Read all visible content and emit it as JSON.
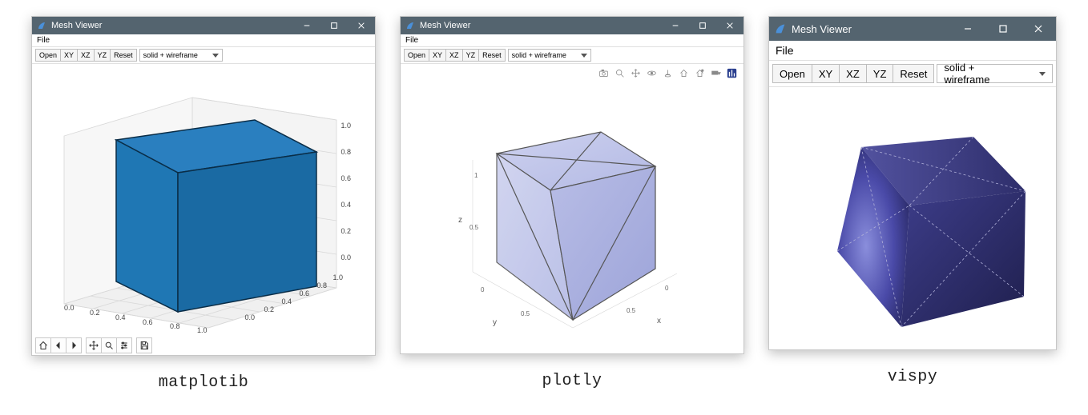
{
  "windows": [
    {
      "id": "mpl",
      "title": "Mesh Viewer",
      "menu": {
        "file": "File"
      },
      "toolbar": {
        "open": "Open",
        "xy": "XY",
        "xz": "XZ",
        "yz": "YZ",
        "reset": "Reset",
        "render_mode": "solid + wireframe"
      },
      "caption": "matplotib"
    },
    {
      "id": "plotly",
      "title": "Mesh Viewer",
      "menu": {
        "file": "File"
      },
      "toolbar": {
        "open": "Open",
        "xy": "XY",
        "xz": "XZ",
        "yz": "YZ",
        "reset": "Reset",
        "render_mode": "solid + wireframe"
      },
      "caption": "plotly"
    },
    {
      "id": "vispy",
      "title": "Mesh Viewer",
      "menu": {
        "file": "File"
      },
      "toolbar": {
        "open": "Open",
        "xy": "XY",
        "xz": "XZ",
        "yz": "YZ",
        "reset": "Reset",
        "render_mode": "solid + wireframe"
      },
      "caption": "vispy"
    }
  ],
  "mpl_nav_icons": [
    "home",
    "back",
    "forward",
    "pan",
    "zoom",
    "configure",
    "save"
  ],
  "plotly_icons": [
    "camera",
    "zoom",
    "pan",
    "rotate",
    "reset-axes",
    "home",
    "last",
    "cam3d",
    "logo"
  ],
  "chart_data": [
    {
      "renderer": "matplotlib",
      "type": "3d-surface",
      "object": "unit-cube",
      "vertices": [
        [
          0,
          0,
          0
        ],
        [
          1,
          0,
          0
        ],
        [
          1,
          1,
          0
        ],
        [
          0,
          1,
          0
        ],
        [
          0,
          0,
          1
        ],
        [
          1,
          0,
          1
        ],
        [
          1,
          1,
          1
        ],
        [
          0,
          1,
          1
        ]
      ],
      "face_color": "#1f77b4",
      "edge_color": "#0a2d47",
      "axes": {
        "x": {
          "ticks": [
            0.0,
            0.2,
            0.4,
            0.6,
            0.8,
            1.0
          ]
        },
        "y": {
          "ticks": [
            0.0,
            0.2,
            0.4,
            0.6,
            0.8,
            1.0
          ]
        },
        "z": {
          "ticks": [
            0.0,
            0.2,
            0.4,
            0.6,
            0.8,
            1.0
          ]
        }
      }
    },
    {
      "renderer": "plotly",
      "type": "mesh3d",
      "object": "unit-cube",
      "vertices": [
        [
          0,
          0,
          0
        ],
        [
          1,
          0,
          0
        ],
        [
          1,
          1,
          0
        ],
        [
          0,
          1,
          0
        ],
        [
          0,
          0,
          1
        ],
        [
          1,
          0,
          1
        ],
        [
          1,
          1,
          1
        ],
        [
          0,
          1,
          1
        ]
      ],
      "color": "#bfc5ea",
      "axes": {
        "x": {
          "label": "x",
          "ticks": [
            0,
            0.5
          ]
        },
        "y": {
          "label": "y",
          "ticks": [
            0,
            0.5
          ]
        },
        "z": {
          "label": "z",
          "ticks": [
            0.5,
            1
          ]
        }
      }
    },
    {
      "renderer": "vispy",
      "type": "mesh",
      "object": "unit-cube",
      "vertices": [
        [
          0,
          0,
          0
        ],
        [
          1,
          0,
          0
        ],
        [
          1,
          1,
          0
        ],
        [
          0,
          1,
          0
        ],
        [
          0,
          0,
          1
        ],
        [
          1,
          0,
          1
        ],
        [
          1,
          1,
          1
        ],
        [
          0,
          1,
          1
        ]
      ],
      "shading": "smooth",
      "color": "#3a3a8f",
      "background": "#ffffff"
    }
  ]
}
